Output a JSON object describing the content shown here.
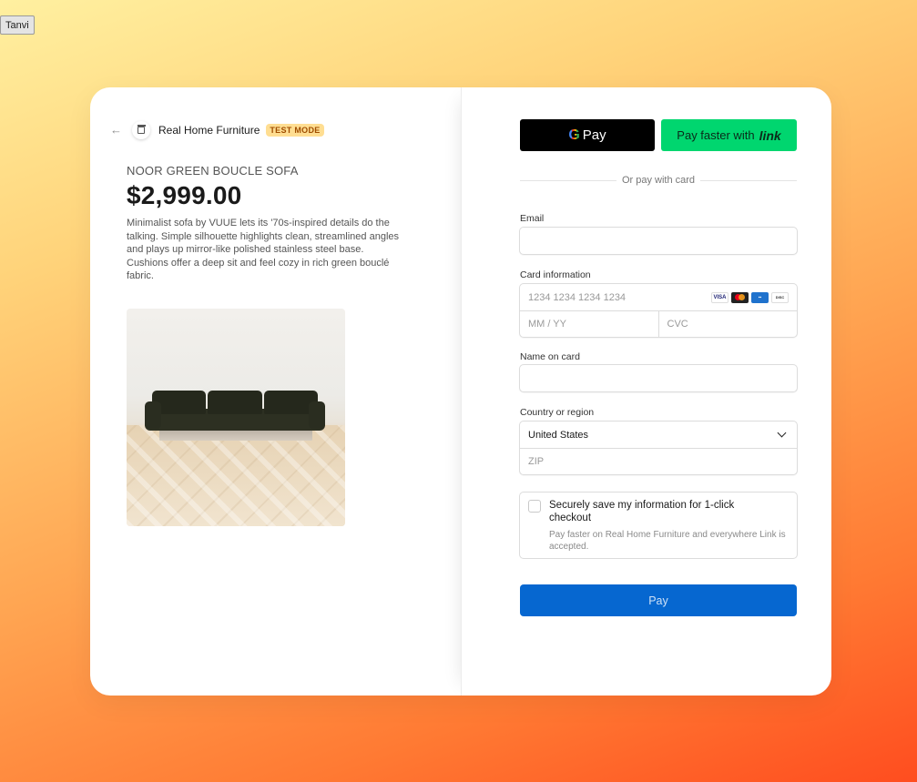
{
  "user_tag": "Tanvi",
  "header": {
    "back_icon": "arrow-left-icon",
    "store_icon": "store-icon",
    "store_name": "Real Home Furniture",
    "badge": "TEST MODE"
  },
  "product": {
    "name": "NOOR GREEN BOUCLE SOFA",
    "price": "$2,999.00",
    "description": "Minimalist sofa by VUUE lets its '70s-inspired details do the talking. Simple silhouette highlights clean, streamlined angles and plays up mirror-like polished stainless steel base. Cushions offer a deep sit and feel cozy in rich green bouclé fabric."
  },
  "payment": {
    "gpay_g": "G",
    "gpay_label": "Pay",
    "link_label": "Pay faster with",
    "link_logo": "link",
    "divider": "Or pay with card",
    "email_label": "Email",
    "email_value": "",
    "card_label": "Card information",
    "card_number_placeholder": "1234 1234 1234 1234",
    "card_brands": [
      "VISA",
      "MC",
      "AMEX",
      "DISCOVER"
    ],
    "expiry_placeholder": "MM / YY",
    "cvc_placeholder": "CVC",
    "name_label": "Name on card",
    "name_value": "",
    "country_label": "Country or region",
    "country_value": "United States",
    "zip_placeholder": "ZIP",
    "save_title": "Securely save my information for 1-click checkout",
    "save_subtitle": "Pay faster on Real Home Furniture and everywhere Link is accepted.",
    "pay_button": "Pay"
  },
  "colors": {
    "pay_button": "#0667d0",
    "link_button": "#00d66f",
    "badge_bg": "#ffde92",
    "badge_text": "#a04d00"
  }
}
